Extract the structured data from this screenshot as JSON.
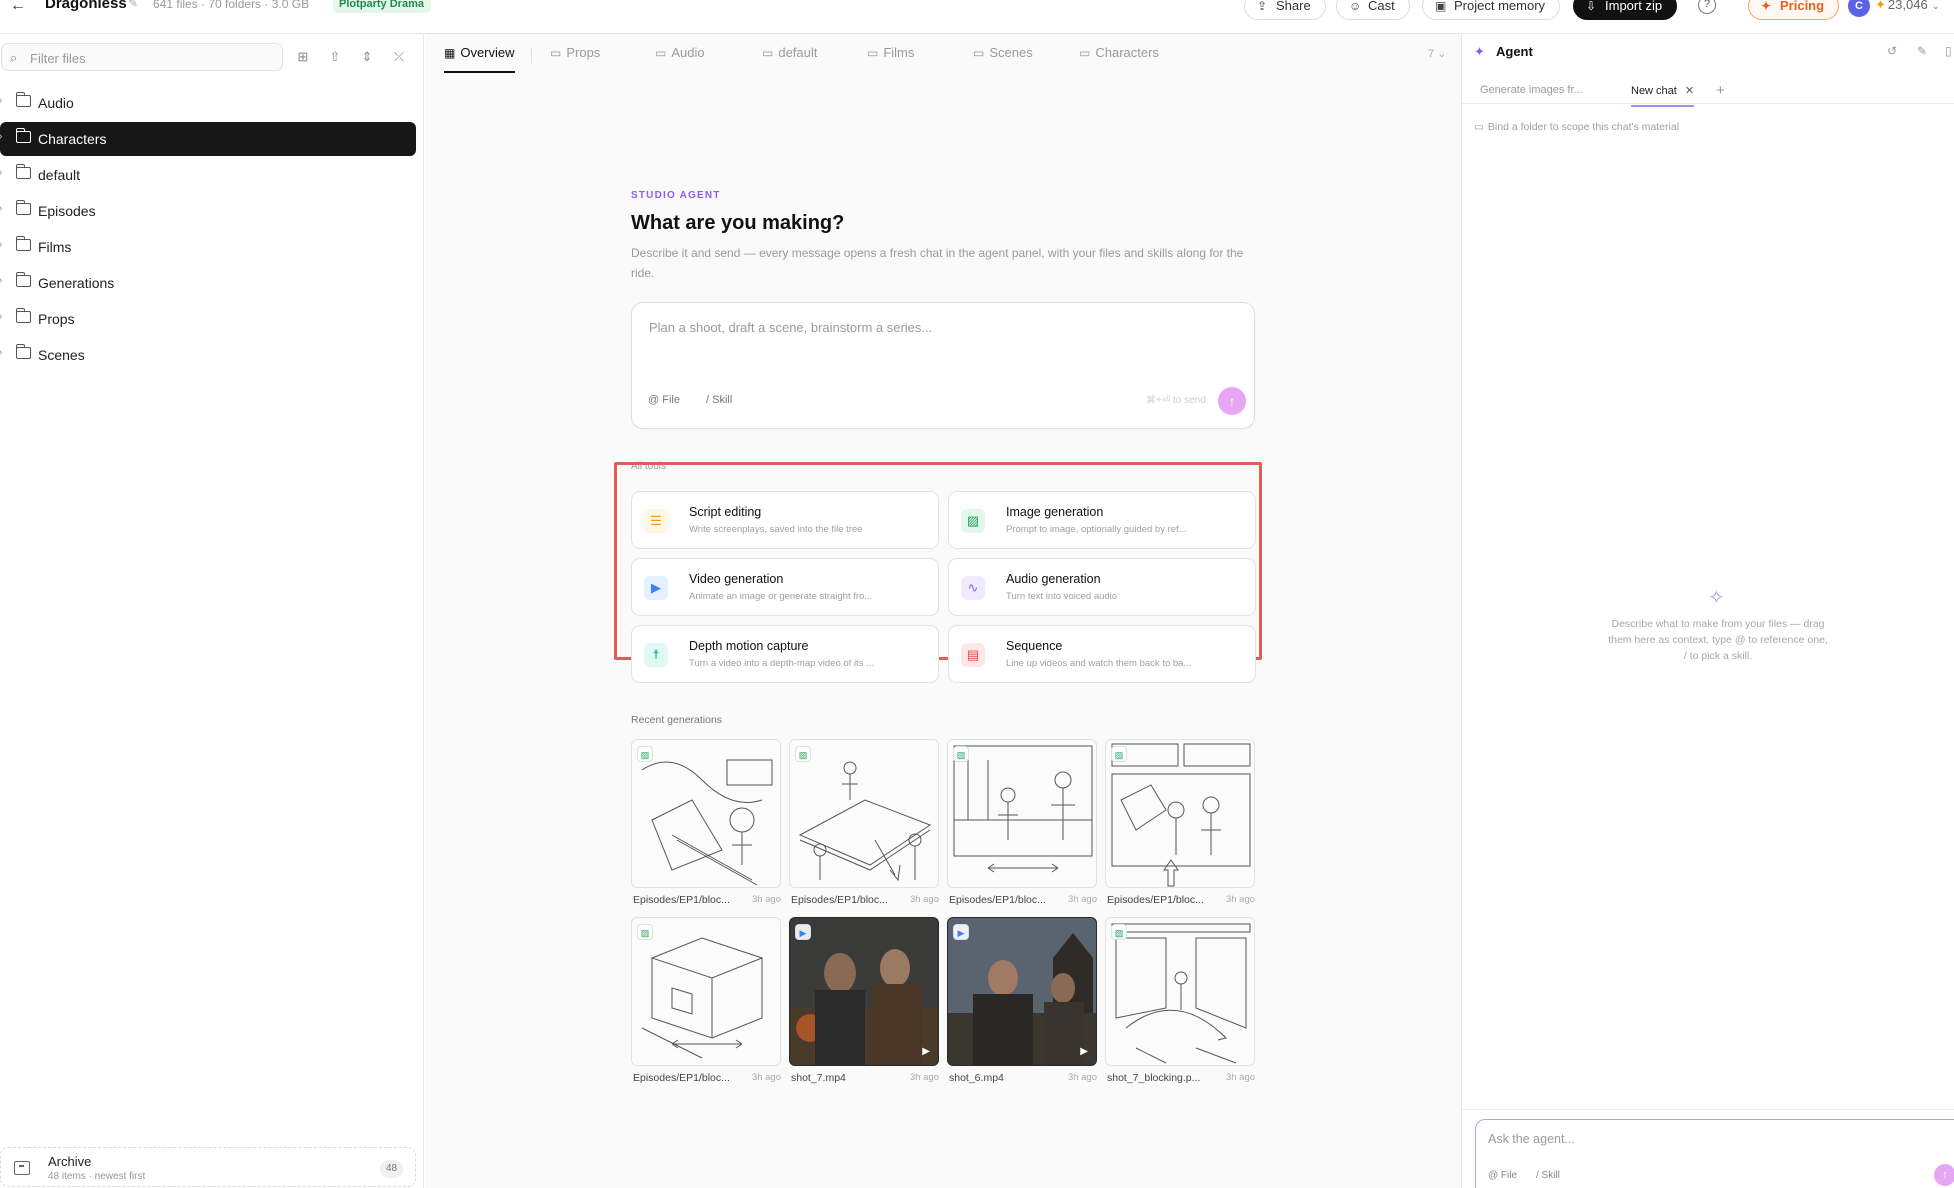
{
  "header": {
    "project_name": "Dragonless",
    "meta": "641 files · 70 folders · 3.0 GB",
    "badge": "Plotparty Drama",
    "share_label": "Share",
    "cast_label": "Cast",
    "memory_label": "Project memory",
    "import_label": "Import zip",
    "pricing_label": "Pricing",
    "avatar_initial": "C",
    "credits": "23,046"
  },
  "sidebar": {
    "filter_placeholder": "Filter files",
    "items": [
      {
        "label": "Audio"
      },
      {
        "label": "Characters"
      },
      {
        "label": "default"
      },
      {
        "label": "Episodes"
      },
      {
        "label": "Films"
      },
      {
        "label": "Generations"
      },
      {
        "label": "Props"
      },
      {
        "label": "Scenes"
      }
    ],
    "archive": {
      "title": "Archive",
      "subtitle": "48 items · newest first",
      "count": "48"
    }
  },
  "main": {
    "tabs": [
      {
        "label": "Overview"
      },
      {
        "label": "Props"
      },
      {
        "label": "Audio"
      },
      {
        "label": "default"
      },
      {
        "label": "Films"
      },
      {
        "label": "Scenes"
      },
      {
        "label": "Characters"
      }
    ],
    "tabs_count": "7",
    "kicker": "STUDIO AGENT",
    "headline": "What are you making?",
    "description": "Describe it and send — every message opens a fresh chat in the agent panel, with your files and skills along for the ride.",
    "composer": {
      "placeholder": "Plan a shoot, draft a scene, brainstorm a series...",
      "file_chip": "@ File",
      "skill_chip": "/ Skill",
      "send_hint": "⌘+⏎ to send"
    },
    "tools_label": "All tools",
    "tools": [
      {
        "title": "Script editing",
        "desc": "Write screenplays, saved into the file tree",
        "icon": "script-icon",
        "color": "#f59e0b",
        "bg": "#fff6e0"
      },
      {
        "title": "Image generation",
        "desc": "Prompt to image, optionally guided by ref...",
        "icon": "image-icon",
        "color": "#22a55b",
        "bg": "#e4f7ec"
      },
      {
        "title": "Video generation",
        "desc": "Animate an image or generate straight fro...",
        "icon": "video-icon",
        "color": "#3b82f6",
        "bg": "#e5f0fe"
      },
      {
        "title": "Audio generation",
        "desc": "Turn text into voiced audio",
        "icon": "waveform-icon",
        "color": "#8b5cf6",
        "bg": "#f0eafe"
      },
      {
        "title": "Depth motion capture",
        "desc": "Turn a video into a depth-map video of its ...",
        "icon": "figure-icon",
        "color": "#14b8a6",
        "bg": "#e2f8f5"
      },
      {
        "title": "Sequence",
        "desc": "Line up videos and watch them back to ba...",
        "icon": "film-icon",
        "color": "#ef4444",
        "bg": "#fde8e8"
      }
    ],
    "recent_label": "Recent generations",
    "recent": [
      {
        "name": "Episodes/EP1/bloc...",
        "ago": "3h ago",
        "kind": "image"
      },
      {
        "name": "Episodes/EP1/bloc...",
        "ago": "3h ago",
        "kind": "image"
      },
      {
        "name": "Episodes/EP1/bloc...",
        "ago": "3h ago",
        "kind": "image"
      },
      {
        "name": "Episodes/EP1/bloc...",
        "ago": "3h ago",
        "kind": "image"
      },
      {
        "name": "Episodes/EP1/bloc...",
        "ago": "3h ago",
        "kind": "image"
      },
      {
        "name": "shot_7.mp4",
        "ago": "3h ago",
        "kind": "video"
      },
      {
        "name": "shot_6.mp4",
        "ago": "3h ago",
        "kind": "video"
      },
      {
        "name": "shot_7_blocking.p...",
        "ago": "3h ago",
        "kind": "image"
      }
    ]
  },
  "agent": {
    "title": "Agent",
    "tabs": [
      {
        "label": "Generate images fr..."
      },
      {
        "label": "New chat"
      }
    ],
    "bind_text": "Bind a folder to scope this chat's material",
    "empty_text": "Describe what to make from your files — drag them here as context, type @ to reference one, / to pick a skill.",
    "ask_placeholder": "Ask the agent...",
    "file_chip": "@ File",
    "skill_chip": "/ Skill"
  }
}
